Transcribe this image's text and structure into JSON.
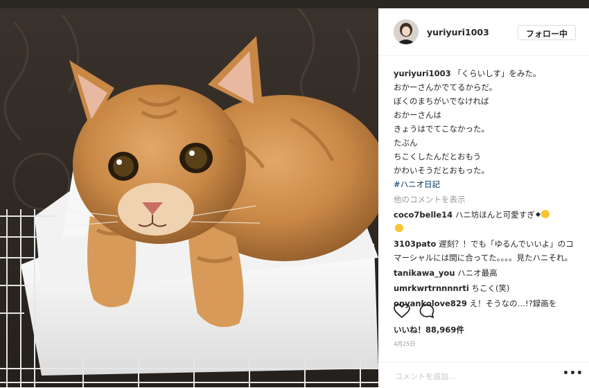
{
  "post": {
    "username": "yuriyuri1003",
    "follow_label": "フォロー中",
    "caption": {
      "username": "yuriyuri1003",
      "lines": [
        "「くらいしす」をみた。",
        "おかーさんかでてるからだ。",
        "ぼくのまちがいでなければ",
        "おかーさんは",
        "きょうはでてこなかった。",
        "たぶん",
        "ちこくしたんだとおもう",
        "かわいそうだとおもった。"
      ],
      "hashtag": "#ハニオ日記"
    },
    "view_more": "他のコメントを表示",
    "comments": [
      {
        "user": "coco7belle14",
        "text": "ハニ坊ほんと可愛すぎ"
      },
      {
        "user": "3103pato",
        "text": "遅刻？！でも「ゆるんでいいよ」のコマーシャルには間に合ってた。。。。見たハニそれ。"
      },
      {
        "user": "tanikawa_you",
        "text": "ハニオ最高"
      },
      {
        "user": "umrkwrtrnnnnrti",
        "text": "ちこく(笑)"
      },
      {
        "user": "onyankolove829",
        "text": "え！そうなの…!?録画を"
      }
    ],
    "likes": "いいね！88,969件",
    "date": "4月25日",
    "add_comment_placeholder": "コメントを追加...",
    "more_options": "•••",
    "icons": {
      "like": "heart-outline-icon",
      "comment": "comment-bubble-icon"
    }
  }
}
